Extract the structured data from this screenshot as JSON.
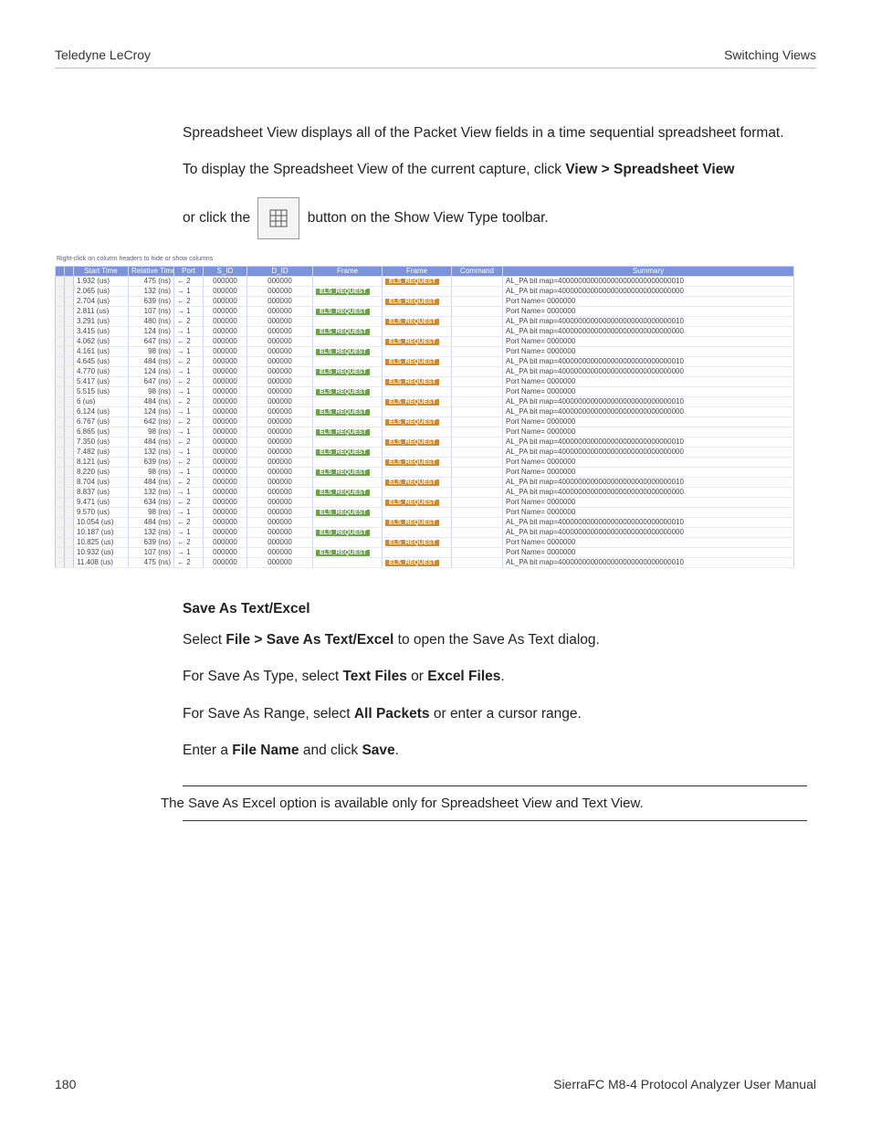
{
  "header": {
    "left": "Teledyne LeCroy",
    "right": "Switching Views"
  },
  "intro": {
    "p1": "Spreadsheet View displays all of the Packet View fields in a time sequential spreadsheet format.",
    "p2_a": "To display the Spreadsheet View of the current capture, click ",
    "p2_b": "View > Spreadsheet View",
    "p3_a": "or click the ",
    "p3_b": " button on the Show View Type toolbar."
  },
  "table": {
    "caption": "Right-click on column headers to hide or show columns",
    "headers": {
      "start_time": "Start Time",
      "relative_time": "Relative Time",
      "port": "Port",
      "sid": "S_ID",
      "did": "D_ID",
      "frame1": "Frame",
      "frame2": "Frame",
      "command": "Command",
      "summary": "Summary"
    },
    "rows": [
      {
        "st": "1.932 (us)",
        "rt": "475 (ns)",
        "port": "← 2",
        "sid": "000000",
        "did": "000000",
        "f1": false,
        "f2": true,
        "sum": "AL_PA bit map=4000000000000000000000000000010"
      },
      {
        "st": "2.065 (us)",
        "rt": "132 (ns)",
        "port": "→ 1",
        "sid": "000000",
        "did": "000000",
        "f1": true,
        "f2": false,
        "sum": "AL_PA bit map=4000000000000000000000000000000"
      },
      {
        "st": "2.704 (us)",
        "rt": "639 (ns)",
        "port": "← 2",
        "sid": "000000",
        "did": "000000",
        "f1": false,
        "f2": true,
        "sum": "Port Name= 0000000"
      },
      {
        "st": "2.811 (us)",
        "rt": "107 (ns)",
        "port": "→ 1",
        "sid": "000000",
        "did": "000000",
        "f1": true,
        "f2": false,
        "sum": "Port Name= 0000000"
      },
      {
        "st": "3.291 (us)",
        "rt": "480 (ns)",
        "port": "← 2",
        "sid": "000000",
        "did": "000000",
        "f1": false,
        "f2": true,
        "sum": "AL_PA bit map=4000000000000000000000000000010"
      },
      {
        "st": "3.415 (us)",
        "rt": "124 (ns)",
        "port": "→ 1",
        "sid": "000000",
        "did": "000000",
        "f1": true,
        "f2": false,
        "sum": "AL_PA bit map=4000000000000000000000000000000"
      },
      {
        "st": "4.062 (us)",
        "rt": "647 (ns)",
        "port": "← 2",
        "sid": "000000",
        "did": "000000",
        "f1": false,
        "f2": true,
        "sum": "Port Name= 0000000"
      },
      {
        "st": "4.161 (us)",
        "rt": "98 (ns)",
        "port": "→ 1",
        "sid": "000000",
        "did": "000000",
        "f1": true,
        "f2": false,
        "sum": "Port Name= 0000000"
      },
      {
        "st": "4.645 (us)",
        "rt": "484 (ns)",
        "port": "← 2",
        "sid": "000000",
        "did": "000000",
        "f1": false,
        "f2": true,
        "sum": "AL_PA bit map=4000000000000000000000000000010"
      },
      {
        "st": "4.770 (us)",
        "rt": "124 (ns)",
        "port": "→ 1",
        "sid": "000000",
        "did": "000000",
        "f1": true,
        "f2": false,
        "sum": "AL_PA bit map=4000000000000000000000000000000"
      },
      {
        "st": "5.417 (us)",
        "rt": "647 (ns)",
        "port": "← 2",
        "sid": "000000",
        "did": "000000",
        "f1": false,
        "f2": true,
        "sum": "Port Name= 0000000"
      },
      {
        "st": "5.515 (us)",
        "rt": "98 (ns)",
        "port": "→ 1",
        "sid": "000000",
        "did": "000000",
        "f1": true,
        "f2": false,
        "sum": "Port Name= 0000000"
      },
      {
        "st": "6 (us)",
        "rt": "484 (ns)",
        "port": "← 2",
        "sid": "000000",
        "did": "000000",
        "f1": false,
        "f2": true,
        "sum": "AL_PA bit map=4000000000000000000000000000010"
      },
      {
        "st": "6.124 (us)",
        "rt": "124 (ns)",
        "port": "→ 1",
        "sid": "000000",
        "did": "000000",
        "f1": true,
        "f2": false,
        "sum": "AL_PA bit map=4000000000000000000000000000000"
      },
      {
        "st": "6.767 (us)",
        "rt": "642 (ns)",
        "port": "← 2",
        "sid": "000000",
        "did": "000000",
        "f1": false,
        "f2": true,
        "sum": "Port Name= 0000000"
      },
      {
        "st": "6.865 (us)",
        "rt": "98 (ns)",
        "port": "→ 1",
        "sid": "000000",
        "did": "000000",
        "f1": true,
        "f2": false,
        "sum": "Port Name= 0000000"
      },
      {
        "st": "7.350 (us)",
        "rt": "484 (ns)",
        "port": "← 2",
        "sid": "000000",
        "did": "000000",
        "f1": false,
        "f2": true,
        "sum": "AL_PA bit map=4000000000000000000000000000010"
      },
      {
        "st": "7.482 (us)",
        "rt": "132 (ns)",
        "port": "→ 1",
        "sid": "000000",
        "did": "000000",
        "f1": true,
        "f2": false,
        "sum": "AL_PA bit map=4000000000000000000000000000000"
      },
      {
        "st": "8.121 (us)",
        "rt": "639 (ns)",
        "port": "← 2",
        "sid": "000000",
        "did": "000000",
        "f1": false,
        "f2": true,
        "sum": "Port Name= 0000000"
      },
      {
        "st": "8.220 (us)",
        "rt": "98 (ns)",
        "port": "→ 1",
        "sid": "000000",
        "did": "000000",
        "f1": true,
        "f2": false,
        "sum": "Port Name= 0000000"
      },
      {
        "st": "8.704 (us)",
        "rt": "484 (ns)",
        "port": "← 2",
        "sid": "000000",
        "did": "000000",
        "f1": false,
        "f2": true,
        "sum": "AL_PA bit map=4000000000000000000000000000010"
      },
      {
        "st": "8.837 (us)",
        "rt": "132 (ns)",
        "port": "→ 1",
        "sid": "000000",
        "did": "000000",
        "f1": true,
        "f2": false,
        "sum": "AL_PA bit map=4000000000000000000000000000000"
      },
      {
        "st": "9.471 (us)",
        "rt": "634 (ns)",
        "port": "← 2",
        "sid": "000000",
        "did": "000000",
        "f1": false,
        "f2": true,
        "sum": "Port Name= 0000000"
      },
      {
        "st": "9.570 (us)",
        "rt": "98 (ns)",
        "port": "→ 1",
        "sid": "000000",
        "did": "000000",
        "f1": true,
        "f2": false,
        "sum": "Port Name= 0000000"
      },
      {
        "st": "10.054 (us)",
        "rt": "484 (ns)",
        "port": "← 2",
        "sid": "000000",
        "did": "000000",
        "f1": false,
        "f2": true,
        "sum": "AL_PA bit map=4000000000000000000000000000010"
      },
      {
        "st": "10.187 (us)",
        "rt": "132 (ns)",
        "port": "→ 1",
        "sid": "000000",
        "did": "000000",
        "f1": true,
        "f2": false,
        "sum": "AL_PA bit map=4000000000000000000000000000000"
      },
      {
        "st": "10.825 (us)",
        "rt": "639 (ns)",
        "port": "← 2",
        "sid": "000000",
        "did": "000000",
        "f1": false,
        "f2": true,
        "sum": "Port Name= 0000000"
      },
      {
        "st": "10.932 (us)",
        "rt": "107 (ns)",
        "port": "→ 1",
        "sid": "000000",
        "did": "000000",
        "f1": true,
        "f2": false,
        "sum": "Port Name= 0000000"
      },
      {
        "st": "11.408 (us)",
        "rt": "475 (ns)",
        "port": "← 2",
        "sid": "000000",
        "did": "000000",
        "f1": false,
        "f2": true,
        "sum": "AL_PA bit map=4000000000000000000000000000010"
      }
    ],
    "els_label": "ELS_REQUEST"
  },
  "save": {
    "heading": "Save As Text/Excel",
    "p1_a": "Select ",
    "p1_b": "File > Save As Text/Excel",
    "p1_c": " to open the Save As Text dialog.",
    "p2_a": "For Save As Type, select ",
    "p2_b": "Text Files",
    "p2_c": " or ",
    "p2_d": "Excel Files",
    "p2_e": ".",
    "p3_a": "For Save As Range, select ",
    "p3_b": "All Packets",
    "p3_c": " or enter a cursor range.",
    "p4_a": "Enter a ",
    "p4_b": "File Name",
    "p4_c": " and click ",
    "p4_d": "Save",
    "p4_e": ".",
    "note": "The Save As Excel option is available only for Spreadsheet View and Text View."
  },
  "footer": {
    "page": "180",
    "title": "SierraFC M8-4 Protocol Analyzer User Manual"
  }
}
